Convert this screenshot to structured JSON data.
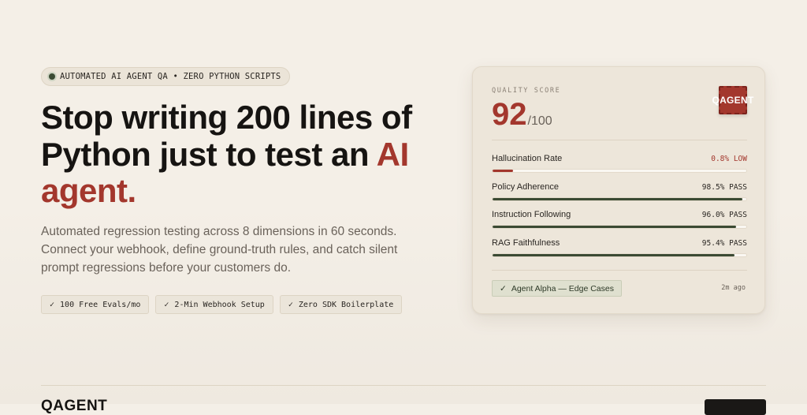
{
  "hero": {
    "badge": "AUTOMATED AI AGENT QA • ZERO PYTHON SCRIPTS",
    "headline_main": "Stop writing 200 lines of Python just to test an ",
    "headline_accent": "AI agent.",
    "subtitle": "Automated regression testing across 8 dimensions in 60 seconds. Connect your webhook, define ground-truth rules, and catch silent prompt regressions before your customers do.",
    "chips": [
      {
        "icon": "check-icon",
        "label": "100 Free Evals/mo"
      },
      {
        "icon": "check-icon",
        "label": "2-Min Webhook Setup"
      },
      {
        "icon": "check-icon",
        "label": "Zero SDK Boilerplate"
      }
    ]
  },
  "card": {
    "label": "QUALITY SCORE",
    "score": "92",
    "score_suffix": "/100",
    "stamp_text": "QAGENT",
    "metrics": [
      {
        "name": "Hallucination Rate",
        "value": "0.8% LOW",
        "fill": 0.08,
        "color": "#a3372d"
      },
      {
        "name": "Policy Adherence",
        "value": "98.5% PASS",
        "fill": 0.985,
        "color": "#3b4a33"
      },
      {
        "name": "Instruction Following",
        "value": "96.0% PASS",
        "fill": 0.96,
        "color": "#3b4a33"
      },
      {
        "name": "RAG Faithfulness",
        "value": "95.4% PASS",
        "fill": 0.954,
        "color": "#3b4a33"
      }
    ],
    "tag_label": "Agent Alpha — Edge Cases",
    "time_ago": "2m ago"
  },
  "footer": {
    "logo": "QAGENT"
  },
  "colors": {
    "accent": "#a3372d",
    "pass": "#3b4a33",
    "background": "#f4efe7"
  }
}
